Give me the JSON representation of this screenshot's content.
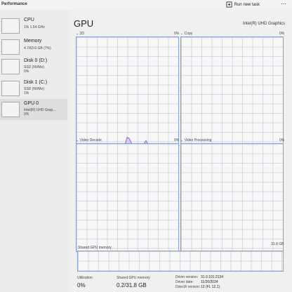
{
  "app": {
    "title": "Performance",
    "run_new_task": "Run new task"
  },
  "sidebar": {
    "items": [
      {
        "name": "CPU",
        "sub1": "1%  1.54 GHz",
        "sub2": ""
      },
      {
        "name": "Memory",
        "sub1": "4.7/63.6 GB (7%)",
        "sub2": ""
      },
      {
        "name": "Disk 0 (D:)",
        "sub1": "SSD (NVMe)",
        "sub2": "0%"
      },
      {
        "name": "Disk 1 (C:)",
        "sub1": "SSD (NVMe)",
        "sub2": "1%"
      },
      {
        "name": "GPU 0",
        "sub1": "Intel(R) UHD Grap...",
        "sub2": "0%"
      }
    ]
  },
  "main": {
    "title": "GPU",
    "model": "Intel(R) UHD Graphics",
    "graphs": [
      {
        "label": "3D",
        "percent": "0%"
      },
      {
        "label": "Copy",
        "percent": "0%"
      },
      {
        "label": "Video Decode",
        "percent": "0%"
      },
      {
        "label": "Video Processing",
        "percent": "0%"
      }
    ],
    "shared_memory": {
      "label": "Shared GPU memory",
      "max": "31.8 GB"
    },
    "stats": {
      "utilization_label": "Utilization",
      "utilization_value": "0%",
      "shared_label": "Shared GPU memory",
      "shared_value": "0.2/31.8 GB"
    },
    "info": [
      {
        "key": "Driver version:",
        "value": "31.0.101.2134"
      },
      {
        "key": "Driver date:",
        "value": "11/20/2024"
      },
      {
        "key": "DirectX version:",
        "value": "12 (FL 12.1)"
      }
    ]
  },
  "colors": {
    "graph_border": "#8aa0c6",
    "graph_line": "#8a6cc0",
    "graph_fill": "#d9cdee"
  },
  "chart_data": {
    "type": "area",
    "label": "3D",
    "values": [
      0,
      0,
      0,
      0,
      0,
      0,
      0,
      0,
      0,
      0,
      0,
      0,
      0,
      0,
      0,
      0,
      0,
      0,
      0,
      0,
      0,
      0,
      0,
      1,
      8,
      7,
      3,
      1,
      0,
      0,
      0,
      0,
      2,
      5,
      1,
      0,
      0,
      0,
      1,
      2,
      0,
      0,
      0,
      0,
      0,
      0,
      0,
      0,
      0,
      0
    ],
    "ylim": [
      0,
      100
    ]
  }
}
